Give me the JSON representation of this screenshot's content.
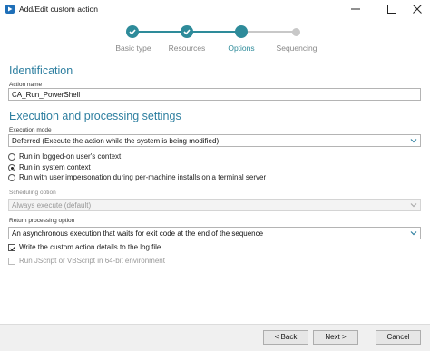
{
  "window": {
    "title": "Add/Edit custom action"
  },
  "wizard": {
    "steps": [
      {
        "label": "Basic type",
        "state": "done"
      },
      {
        "label": "Resources",
        "state": "done"
      },
      {
        "label": "Options",
        "state": "active"
      },
      {
        "label": "Sequencing",
        "state": "pending"
      }
    ]
  },
  "identification": {
    "heading": "Identification",
    "action_name_label": "Action name",
    "action_name_value": "CA_Run_PowerShell"
  },
  "execution": {
    "heading": "Execution and processing settings",
    "mode_label": "Execution mode",
    "mode_value": "Deferred (Execute the action while the system is being modified)",
    "context_options": [
      {
        "label": "Run in logged-on user's context",
        "checked": false
      },
      {
        "label": "Run in system context",
        "checked": true
      },
      {
        "label": "Run with user impersonation during per-machine installs on a terminal server",
        "checked": false
      }
    ],
    "scheduling_label": "Scheduling option",
    "scheduling_value": "Always execute (default)",
    "return_label": "Return processing option",
    "return_value": "An asynchronous execution that waits for exit code at the end of the sequence",
    "write_log_label": "Write the custom action details to the log file",
    "write_log_checked": true,
    "run_64bit_label": "Run JScript or VBScript in 64-bit environment",
    "run_64bit_checked": false
  },
  "footer": {
    "back_label": "< Back",
    "next_label": "Next >",
    "cancel_label": "Cancel"
  },
  "colors": {
    "accent": "#2e8b9a",
    "heading": "#2e7fa0",
    "inactive_step": "#c8c8c8"
  }
}
